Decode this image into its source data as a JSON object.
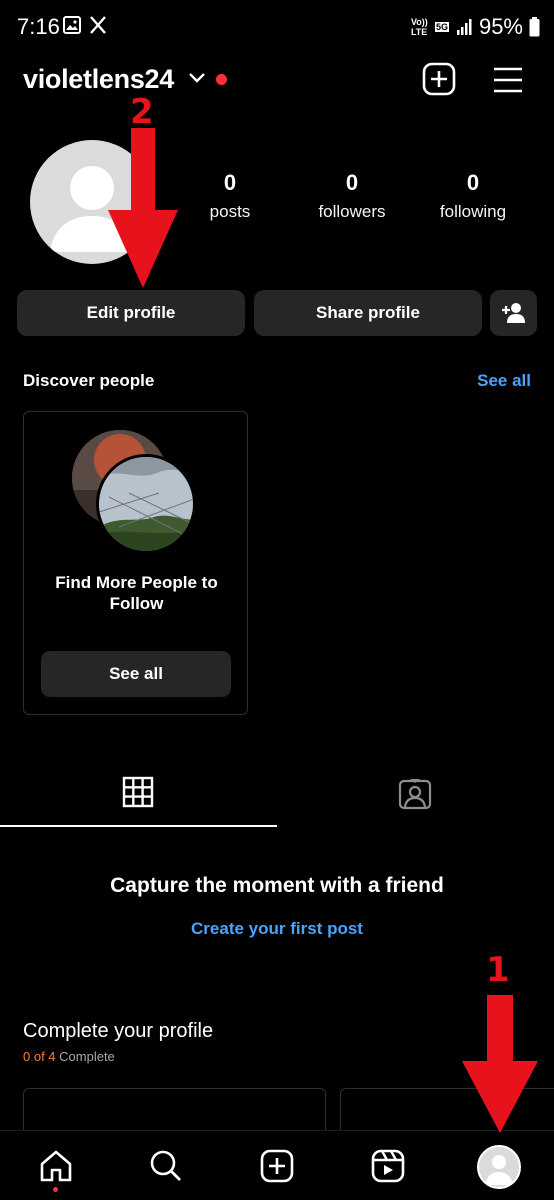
{
  "status_bar": {
    "time": "7:16",
    "battery": "95%",
    "network": "5G",
    "volte": "Vo)) LTE"
  },
  "header": {
    "username": "violetlens24"
  },
  "stats": [
    {
      "count": "0",
      "label": "posts"
    },
    {
      "count": "0",
      "label": "followers"
    },
    {
      "count": "0",
      "label": "following"
    }
  ],
  "actions": {
    "edit_profile": "Edit profile",
    "share_profile": "Share profile"
  },
  "discover": {
    "title": "Discover people",
    "see_all": "See all",
    "card_text": "Find More People to Follow",
    "card_button": "See all"
  },
  "empty_state": {
    "title": "Capture the moment with a friend",
    "link": "Create your first post"
  },
  "complete_profile": {
    "title": "Complete your profile",
    "progress": "0 of 4",
    "suffix": " Complete"
  },
  "annotations": {
    "step_1": "1",
    "step_2": "2"
  },
  "colors": {
    "accent_blue": "#4aa3ff",
    "notification_red": "#ff3040",
    "arrow_red": "#e8121c",
    "button_bg": "#262626"
  },
  "nav_icons": [
    "home-icon",
    "search-icon",
    "create-icon",
    "reels-icon",
    "profile-avatar"
  ]
}
